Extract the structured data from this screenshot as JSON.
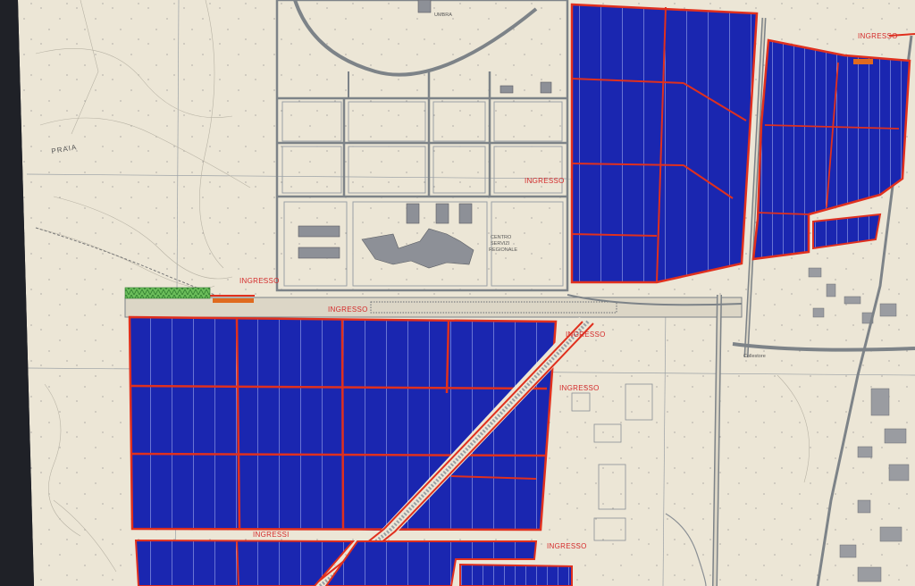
{
  "map": {
    "place_labels": {
      "praia": "PRAIA",
      "centro": "CENTRO",
      "servizi": "SERVIZI",
      "regionale": "REGIONALE",
      "collestore": "Collestore",
      "umbra": "UMBRA"
    },
    "entrance_labels": [
      "INGRESSO",
      "INGRESSO",
      "INGRESSO",
      "INGRESSO",
      "INGRESSO",
      "INGRESSO",
      "INGRESSI",
      "INGRESSO"
    ],
    "colors": {
      "paper": "#ece6d6",
      "panel_fill": "#1a26b0",
      "boundary": "#e0301e",
      "road": "#8a8f94",
      "vegetation": "#3a9a3a",
      "screen_bezel": "#2a2c33"
    },
    "legend_icon": "map-overlay-solar-parks"
  }
}
